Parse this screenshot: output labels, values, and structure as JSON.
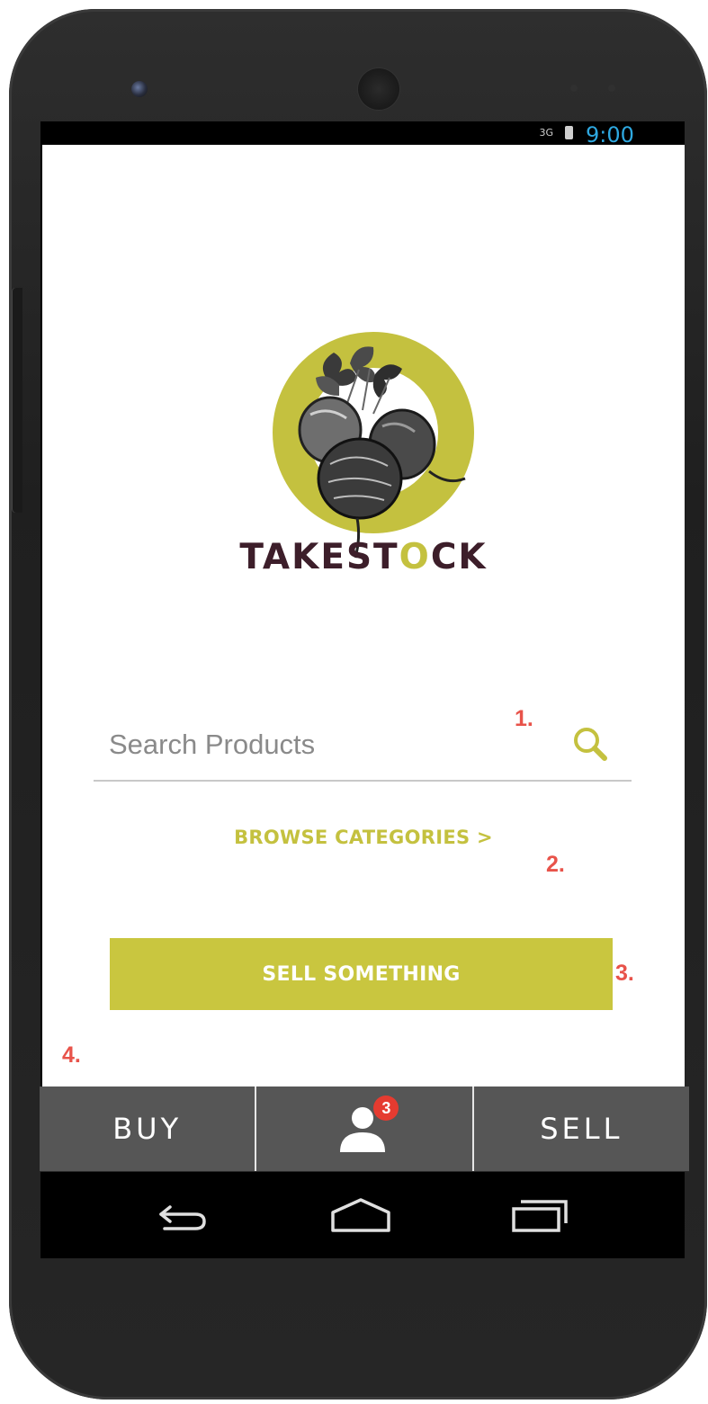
{
  "statusbar": {
    "signal": "3G",
    "time": "9:00",
    "time_color": "#2ea8e0"
  },
  "brand": {
    "name_before_o": "TAKEST",
    "name_o": "O",
    "name_after_o": "CK",
    "name_color": "#3d1e2a",
    "accent_color": "#c4c13f",
    "logo_icon": "beet-ring-logo-icon"
  },
  "search": {
    "placeholder": "Search Products",
    "value": "",
    "icon": "search-icon"
  },
  "browse": {
    "label": "BROWSE CATEGORIES >"
  },
  "sell_button": {
    "label": "SELL SOMETHING",
    "color": "#c9c63f"
  },
  "annotations": {
    "a1": "1.",
    "a2": "2.",
    "a3": "3.",
    "a4": "4.",
    "color": "#e8534a"
  },
  "bottom_nav": {
    "buy_label": "BUY",
    "profile_icon": "user-icon",
    "profile_badge": "3",
    "sell_label": "SELL",
    "background": "#565656"
  },
  "system_nav": {
    "back_icon": "back-icon",
    "home_icon": "home-icon",
    "recents_icon": "recents-icon"
  }
}
